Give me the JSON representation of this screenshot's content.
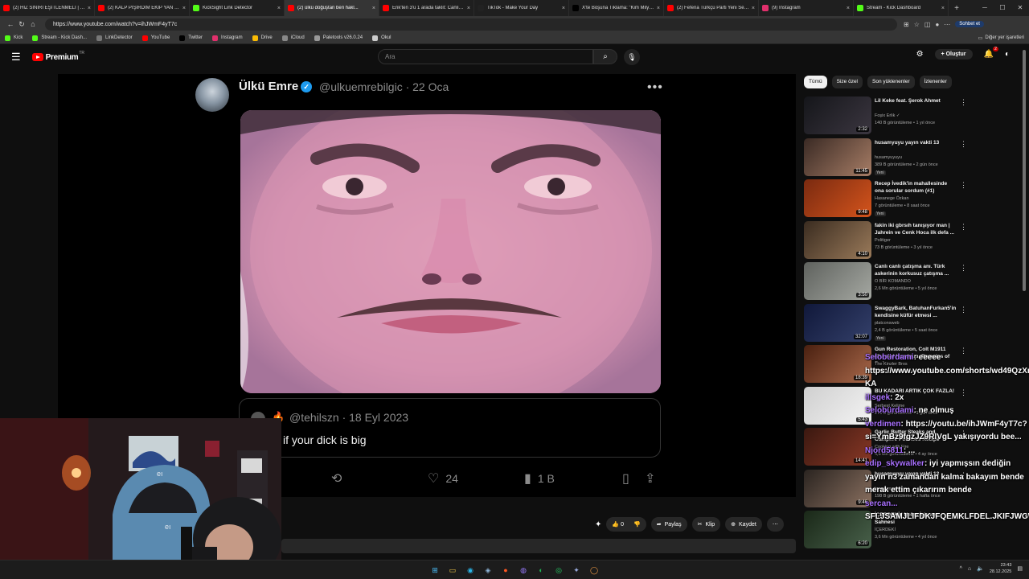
{
  "browser": {
    "tabs": [
      {
        "title": "(2) HIZ SINIRI EŞİTLENMELİ | 5Sn...",
        "icon_color": "#ff0000",
        "active": false
      },
      {
        "title": "(2) KALP PİŞİRDİM EKİP YAN YAT...",
        "icon_color": "#ff0000",
        "active": false
      },
      {
        "title": "KickSight Link Detector",
        "icon_color": "#53fc18",
        "active": false
      },
      {
        "title": "(2) ülkü doğuştan beri hakl...",
        "icon_color": "#ff0000",
        "active": true
      },
      {
        "title": "Erik'ten 3'ü 1 arada taklit: Canlı y...",
        "icon_color": "#ff0000",
        "active": false
      },
      {
        "title": "TikTok - Make Your Day",
        "icon_color": "#222222",
        "active": false
      },
      {
        "title": "X'te Boşuna Tıklama: \"Kim Milyon...",
        "icon_color": "#000000",
        "active": false
      },
      {
        "title": "(2) Fefena Türkçü Parti Yeni Seçi...",
        "icon_color": "#ff0000",
        "active": false
      },
      {
        "title": "(9) Instagram",
        "icon_color": "#e1306c",
        "active": false
      },
      {
        "title": "Stream - Kick Dashboard",
        "icon_color": "#53fc18",
        "active": false
      }
    ],
    "new_tab": "+",
    "url": "https://www.youtube.com/watch?v=ihJWmF4yT7c",
    "chat_button": "Sohbet et",
    "bookmarks": [
      {
        "label": "Kick",
        "icon_color": "#53fc18"
      },
      {
        "label": "Stream - Kick Dash...",
        "icon_color": "#53fc18"
      },
      {
        "label": "LinkDetector",
        "icon_color": "#777777"
      },
      {
        "label": "YouTube",
        "icon_color": "#ff0000"
      },
      {
        "label": "Twitter",
        "icon_color": "#000000"
      },
      {
        "label": "Instagram",
        "icon_color": "#e1306c"
      },
      {
        "label": "Drive",
        "icon_color": "#fbbc04"
      },
      {
        "label": "iCloud",
        "icon_color": "#888888"
      },
      {
        "label": "Paletools v26.0.24",
        "icon_color": "#999999"
      },
      {
        "label": "Okul",
        "icon_color": "#cccccc"
      }
    ],
    "other_bookmarks": "Diğer yer işaretleri"
  },
  "youtube": {
    "logo_text": "Premium",
    "logo_sup": "TR",
    "search_placeholder": "Ara",
    "create_label": "Oluştur",
    "notif_count": "2"
  },
  "tweet": {
    "name": "Ülkü Emre",
    "handle_date": "@ulkuemrebilgic · 22 Oca",
    "quote_handle_date": "@tehilszn · 18 Eyl 2023",
    "quote_text": "if your dick is big",
    "likes": "24",
    "views": "1 B"
  },
  "video_actions": {
    "like_count": "0",
    "share": "Paylaş",
    "clip": "Klip",
    "save": "Kaydet"
  },
  "chips": [
    "Tümü",
    "Size özel",
    "Son yüklenenler",
    "İzlenenler"
  ],
  "recommendations": [
    {
      "title": "Lil Keke feat. Şerok Ahmet",
      "channel": "Foşix Erlik ✓",
      "meta": "140 B görüntüleme • 1 yıl önce",
      "duration": "2:32",
      "new": "",
      "c1": "#15161a",
      "c2": "#3b3640"
    },
    {
      "title": "husamyuyu yayın vakti 13",
      "channel": "husamyuyuyu",
      "meta": "389 B görüntüleme • 2 gün önce",
      "duration": "11:45",
      "new": "Yeni",
      "c1": "#3a2a24",
      "c2": "#a77d66"
    },
    {
      "title": "Recep İvedik'in mahallesinde ona sorular sordum (#1)",
      "channel": "Hasanege Özkan",
      "meta": "7 görüntüleme • 8 saat önce",
      "duration": "9:48",
      "new": "Yeni",
      "c1": "#7a2a10",
      "c2": "#d4541c"
    },
    {
      "title": "fakin iki gbrsıh tanışıyor man | Jahrein ve Cenk Hoca ilk defa ...",
      "channel": "Politiger",
      "meta": "73 B görüntüleme • 3 yıl önce",
      "duration": "4:10",
      "new": "",
      "c1": "#3a2c20",
      "c2": "#9a7a5a"
    },
    {
      "title": "Canlı canlı çatışma anı. Türk askerinin korkusuz çatışma ...",
      "channel": "O BİR KOMANDO",
      "meta": "2,6 Mn görüntüleme • 5 yıl önce",
      "duration": "3:50",
      "new": "",
      "c1": "#5f625e",
      "c2": "#a5a8a2"
    },
    {
      "title": "SwaggyBark, BatuhanFurkan5'in kendisine küfür etmesi ...",
      "channel": "platconsweb",
      "meta": "2,4 B görüntüleme • 5 saat önce",
      "duration": "32:07",
      "new": "Yeni",
      "c1": "#10183a",
      "c2": "#34406a"
    },
    {
      "title": "Gun Restoration, Colt M1911 (Cursed Handgun, Remains of fire).",
      "channel": "The Kinzler Bros",
      "meta": "1,4 Mn görüntüleme • 2 yıl önce",
      "duration": "18:39",
      "new": "",
      "c1": "#4a2010",
      "c2": "#a8684a"
    },
    {
      "title": "BU KADARI ARTIK ÇOK FAZLA!",
      "channel": "Serbest Kelime",
      "meta": "273 B görüntüleme • 1 gün önce",
      "duration": "5:43",
      "new": "",
      "c1": "#cfcfcf",
      "c2": "#f4f4f4"
    },
    {
      "title": "Garlic Butter Steaks and Campfire Potatoes Recipe",
      "channel": "Cooking with Fire",
      "meta": "4,6 Mn görüntüleme • 4 ay önce",
      "duration": "14:41",
      "new": "",
      "c1": "#3a1810",
      "c2": "#8a3826"
    },
    {
      "title": "husamyuyu yayın vakti 12",
      "channel": "husamyuyuyu",
      "meta": "198 B görüntüleme • 1 hafta önce",
      "duration": "9:46",
      "new": "",
      "c1": "#2a2420",
      "c2": "#8a7060"
    },
    {
      "title": "İÇERDEKİ | Nefes İçişme Sahnesi",
      "channel": "İÇERDEKİ",
      "meta": "3,6 Mn görüntüleme • 4 yıl önce",
      "duration": "6:20",
      "new": "",
      "c1": "#1a2818",
      "c2": "#48604a"
    }
  ],
  "chat": [
    {
      "user": "Selobürdami",
      "text": ": eeeee"
    },
    {
      "user": "",
      "text": "https://www.youtube.com/shorts/wd49QzXr"
    },
    {
      "user": "",
      "text": "KA"
    },
    {
      "user": "ilisgek",
      "text": ": 2x"
    },
    {
      "user": "Selobürdami",
      "text": ": ne olmuş"
    },
    {
      "user": "verdimen",
      "text": ": https://youtu.be/ihJWmF4yT7c?"
    },
    {
      "user": "",
      "text": "si=YmBz9fgzJZ9RlVgL yakışıyordu bee..."
    },
    {
      "user": "Njord5811",
      "text": ": ..."
    },
    {
      "user": "edip_skywalker",
      "text": ": iyi yapmışsın dediğin"
    },
    {
      "user": "",
      "text": "yayın n3 zamandan kalma bakayım bende"
    },
    {
      "user": "",
      "text": "merak ettim çıkarırım bende"
    },
    {
      "user": "sercan...",
      "text": ""
    },
    {
      "user": "",
      "text": "SFLJSAMJLIFDKJFQEMKLFDEL.JKIFJWGW"
    }
  ],
  "taskbar": {
    "time": "23:43",
    "date": "28.12.2025"
  }
}
